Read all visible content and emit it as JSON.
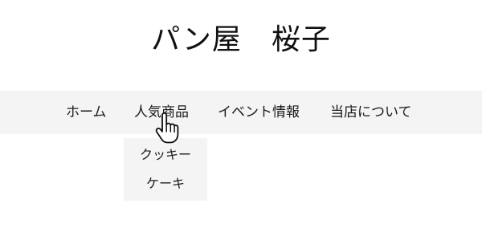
{
  "header": {
    "site_title": "パン屋　桜子"
  },
  "nav": {
    "items": [
      {
        "label": "ホーム"
      },
      {
        "label": "人気商品"
      },
      {
        "label": "イベント情報"
      },
      {
        "label": "当店について"
      }
    ]
  },
  "dropdown": {
    "items": [
      {
        "label": "クッキー"
      },
      {
        "label": "ケーキ"
      }
    ]
  },
  "cursor": {
    "icon": "pointer-hand-icon"
  }
}
